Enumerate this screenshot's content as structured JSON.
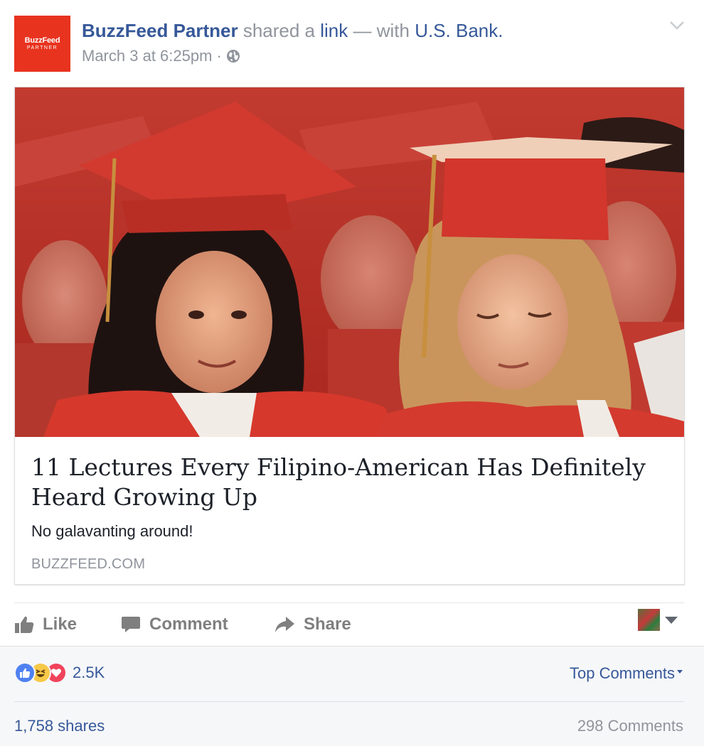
{
  "post": {
    "page_name": "BuzzFeed Partner",
    "shared_text": " shared a ",
    "link_word": "link",
    "with_text": " — with ",
    "tagged_page": "U.S. Bank.",
    "timestamp": "March 3 at 6:25pm",
    "separator": "·",
    "privacy_icon": "globe-icon",
    "avatar_logo_main": "BuzzFeed",
    "avatar_logo_sub": "PARTNER",
    "avatar_color": "#e8331f"
  },
  "attachment": {
    "title": "11 Lectures Every Filipino-American Has Definitely Heard Growing Up",
    "description": "No galavanting around!",
    "domain": "BUZZFEED.COM",
    "image_subject": "graduation photo: two women in red graduation caps and gowns"
  },
  "actions": {
    "like_label": "Like",
    "comment_label": "Comment",
    "share_label": "Share"
  },
  "footer": {
    "reaction_count": "2.5K",
    "reactions": [
      "like-icon",
      "haha-icon",
      "love-icon"
    ],
    "top_comments_label": "Top Comments",
    "shares_label": "1,758 shares",
    "comments_label": "298 Comments"
  },
  "colors": {
    "link_blue": "#365899",
    "meta_gray": "#90949c",
    "action_gray": "#7f7f7f",
    "footer_bg": "#f6f7f9",
    "like_blue": "#4f81f1",
    "haha_yellow": "#f7c948",
    "love_red": "#f0445b"
  }
}
